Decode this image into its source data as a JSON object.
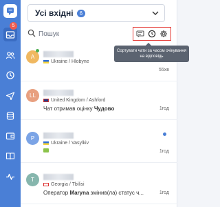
{
  "rail": {
    "badge": "5"
  },
  "header": {
    "title": "Усі вхідні",
    "count": "6"
  },
  "search": {
    "placeholder": "Пошук"
  },
  "tooltip": {
    "text": "Сортувати чати за часом очікування на відповідь"
  },
  "chats": [
    {
      "initial": "A",
      "avatar_color": "#f0b860",
      "location": "Ukraine / Hlobyne",
      "message": "",
      "time": "55хв",
      "online": true,
      "unread": false
    },
    {
      "initial": "LL",
      "avatar_color": "#e8a080",
      "location": "United Kingdom / Ashford",
      "message_prefix": "Чат отримав оцінку ",
      "message_bold": "Чудово",
      "time": "1год",
      "online": false,
      "unread": false
    },
    {
      "initial": "P",
      "avatar_color": "#7ba4e6",
      "location": "Ukraine / Vasylkiv",
      "message": "",
      "time": "1год",
      "online": false,
      "unread": true
    },
    {
      "initial": "T",
      "avatar_color": "#86b6ad",
      "location": "Georgia / Tbilisi",
      "message_prefix": "Оператор ",
      "message_bold": "Maryna",
      "message_suffix": " змінив(ла) статус ч...",
      "time": "1год",
      "online": false,
      "unread": false
    }
  ]
}
